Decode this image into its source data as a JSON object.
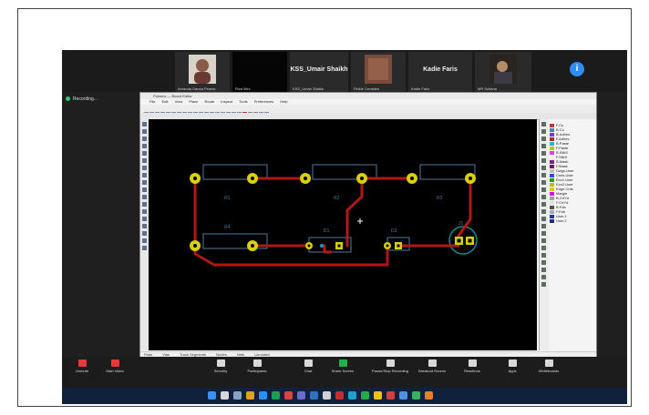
{
  "meeting": {
    "participants": [
      {
        "caption": "Amanda Garcia Pearse",
        "has_video": true
      },
      {
        "caption": "Riza Mirz",
        "has_video": false
      },
      {
        "name": "KSS_Umair Shaikh",
        "caption": "KSS_Umair Shaikh",
        "has_video": false
      },
      {
        "caption": "Pinkie Ceraldes",
        "has_video": true
      },
      {
        "name": "Kadie Faris",
        "caption": "Kadie Faris",
        "has_video": false
      },
      {
        "caption": "MR Sultana",
        "has_video": true
      }
    ],
    "recording_label": "Recording...",
    "controls": [
      {
        "label": "Unmute",
        "icon": "mic-icon"
      },
      {
        "label": "Start Video",
        "icon": "camera-icon"
      },
      {
        "label": "Security",
        "icon": "shield-icon"
      },
      {
        "label": "Participants",
        "icon": "people-icon"
      },
      {
        "label": "Chat",
        "icon": "chat-icon"
      },
      {
        "label": "Share Screen",
        "icon": "share-icon"
      },
      {
        "label": "Pause/Stop Recording",
        "icon": "record-icon"
      },
      {
        "label": "Breakout Rooms",
        "icon": "rooms-icon"
      },
      {
        "label": "Reactions",
        "icon": "reaction-icon"
      },
      {
        "label": "Apps",
        "icon": "apps-icon"
      },
      {
        "label": "Whiteboards",
        "icon": "whiteboard-icon"
      }
    ],
    "info_icon": "i"
  },
  "kicad": {
    "title": "Pcbnew — Board Editor",
    "menus": [
      "File",
      "Edit",
      "View",
      "Place",
      "Route",
      "Inspect",
      "Tools",
      "Preferences",
      "Help"
    ],
    "status_items": [
      "Pads",
      "Vias",
      "Track Segments",
      "Nodes",
      "Nets",
      "Unrouted"
    ],
    "components": [
      "R1",
      "R2",
      "R3",
      "R4",
      "D1",
      "D2",
      "J1"
    ],
    "layers": [
      {
        "name": "F.Cu",
        "color": "#c83434"
      },
      {
        "name": "B.Cu",
        "color": "#4d7fc4"
      },
      {
        "name": "B.Adhes",
        "color": "#8a2be2"
      },
      {
        "name": "F.Adhes",
        "color": "#a52a2a"
      },
      {
        "name": "B.Paste",
        "color": "#00c2c2"
      },
      {
        "name": "F.Paste",
        "color": "#c2c200"
      },
      {
        "name": "B.SilkS",
        "color": "#e040e0"
      },
      {
        "name": "F.SilkS",
        "color": "#f0f0f0"
      },
      {
        "name": "B.Mask",
        "color": "#802080"
      },
      {
        "name": "F.Mask",
        "color": "#801060"
      },
      {
        "name": "Dwgs.User",
        "color": "#c0c0c0"
      },
      {
        "name": "Cmts.User",
        "color": "#4040ff"
      },
      {
        "name": "Eco1.User",
        "color": "#20a020"
      },
      {
        "name": "Eco2.User",
        "color": "#c0c000"
      },
      {
        "name": "Edge.Cuts",
        "color": "#d0d000"
      },
      {
        "name": "Margin",
        "color": "#e000e0"
      },
      {
        "name": "B.CrtYd",
        "color": "#a0a0a0"
      },
      {
        "name": "F.CrtYd",
        "color": "#e0e0e0"
      },
      {
        "name": "B.Fab",
        "color": "#505050"
      },
      {
        "name": "F.Fab",
        "color": "#a8a8a8"
      },
      {
        "name": "User.1",
        "color": "#2030a0"
      },
      {
        "name": "User.2",
        "color": "#203080"
      }
    ]
  },
  "colors": {
    "pad": "#d8d000",
    "track": "#b01818",
    "silkscreen": "#4a7a9a",
    "courtyard": "#1a8a8a",
    "zoom_accent": "#2d8cff",
    "record_green": "#22b04b"
  }
}
